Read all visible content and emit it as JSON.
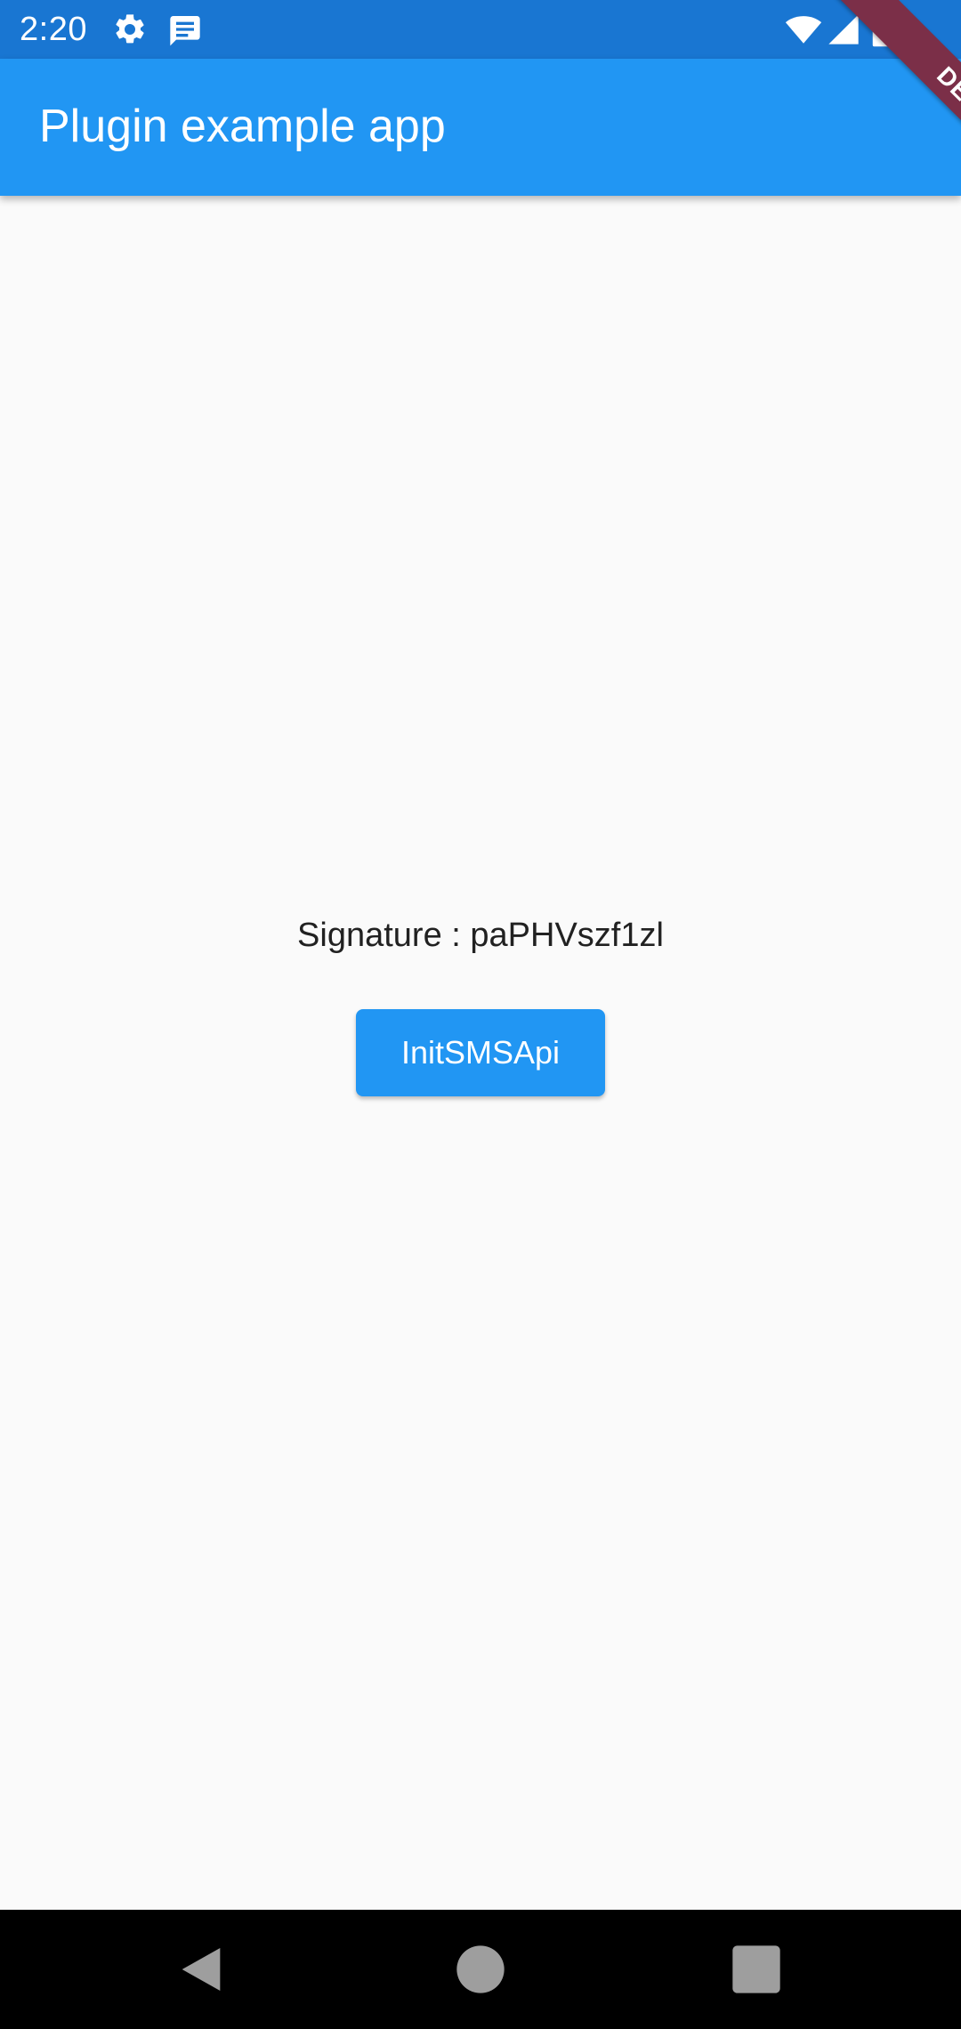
{
  "status_bar": {
    "time": "2:20",
    "icons": [
      "settings-gear-icon",
      "message-notification-icon",
      "wifi-icon",
      "cell-signal-icon",
      "battery-charging-icon"
    ],
    "color": "#1976d2"
  },
  "app_bar": {
    "title": "Plugin example app",
    "color": "#2196f3"
  },
  "debug_banner": {
    "label": "DEBUG",
    "color": "#7b2f48"
  },
  "main": {
    "signature_text": "Signature : paPHVszf1zl",
    "init_button_label": "InitSMSApi"
  },
  "nav_bar": {
    "icons": [
      "back-triangle-icon",
      "home-circle-icon",
      "recents-square-icon"
    ]
  }
}
